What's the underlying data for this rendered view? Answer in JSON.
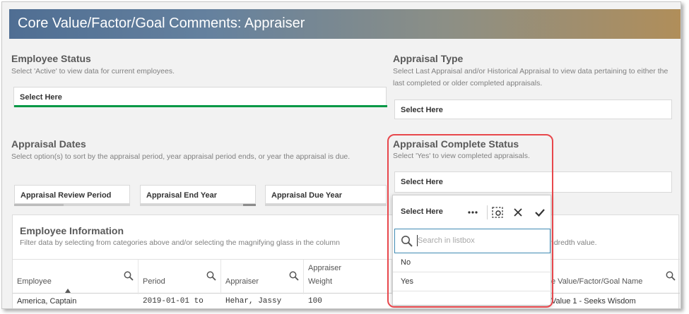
{
  "title": "Core Value/Factor/Goal Comments: Appraiser",
  "employee_status": {
    "title": "Employee Status",
    "desc": "Select 'Active' to view data for current employees.",
    "select_label": "Select Here"
  },
  "appraisal_type": {
    "title": "Appraisal Type",
    "desc": "Select Last Appraisal and/or Historical Appraisal to view data pertaining to either the last completed or older completed appraisals.",
    "select_label": "Select Here"
  },
  "appraisal_dates": {
    "title": "Appraisal Dates",
    "desc": "Select option(s) to sort by the appraisal period, year appraisal period ends, or year the appraisal is due.",
    "buttons": [
      "Appraisal Review Period",
      "Appraisal End Year",
      "Appraisal Due Year"
    ]
  },
  "appraisal_complete": {
    "title": "Appraisal Complete Status",
    "desc": "Select 'Yes' to view completed appraisals.",
    "select_label": "Select Here"
  },
  "listbox": {
    "title": "Select Here",
    "search_placeholder": "Search in listbox",
    "options": [
      "No",
      "Yes"
    ]
  },
  "employee_info": {
    "title": "Employee Information",
    "desc": "Filter data by selecting from categories above and/or selecting the magnifying glass in the column",
    "desc_tail": "ndredth value.",
    "columns": [
      "Employee",
      "Period",
      "Appraiser",
      "Appraiser Weight",
      "",
      "e Value/Factor/Goal Name"
    ],
    "row": [
      "America, Captain",
      "2019-01-01 to",
      "Hehar, Jassy",
      "100",
      "",
      "Value 1 - Seeks Wisdom"
    ]
  }
}
